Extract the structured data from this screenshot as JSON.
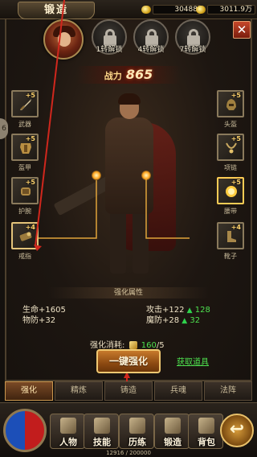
{
  "header": {
    "title": "锻造",
    "gold": "30488",
    "ingot": "3011.9万"
  },
  "portrait": {
    "name": "hero-portrait"
  },
  "locks": [
    {
      "label": "1转解锁"
    },
    {
      "label": "4转解锁"
    },
    {
      "label": "7转解锁"
    }
  ],
  "power": {
    "label": "战力",
    "value": "865"
  },
  "left_slots": [
    {
      "label": "武器",
      "plus": "+5"
    },
    {
      "label": "盔甲",
      "plus": "+5"
    },
    {
      "label": "护腕",
      "plus": "+5"
    },
    {
      "label": "戒指",
      "plus": "+4"
    }
  ],
  "right_slots": [
    {
      "label": "头盔",
      "plus": "+5"
    },
    {
      "label": "项链",
      "plus": "+5"
    },
    {
      "label": "腰带",
      "plus": "+5"
    },
    {
      "label": "靴子",
      "plus": "+4"
    }
  ],
  "attributes": {
    "title": "强化属性",
    "hp": "生命+1605",
    "pdef": "物防+32",
    "atk": "攻击+122",
    "atk_gain": "128",
    "mdef": "魔防+28",
    "mdef_gain": "32"
  },
  "cost": {
    "label": "强化消耗:",
    "amount": "160",
    "sep": "/",
    "need": "5"
  },
  "actions": {
    "upgrade": "一键强化",
    "get_items": "获取道具"
  },
  "tabs": [
    "强化",
    "精炼",
    "铸造",
    "兵魂",
    "法阵"
  ],
  "bottom_nav": [
    "人物",
    "技能",
    "历练",
    "锻造",
    "背包"
  ],
  "xp": "12916 / 200000",
  "colors": {
    "accent_gold": "#f0c872",
    "gain_green": "#4ee04f",
    "alert_red": "#d0271d"
  }
}
